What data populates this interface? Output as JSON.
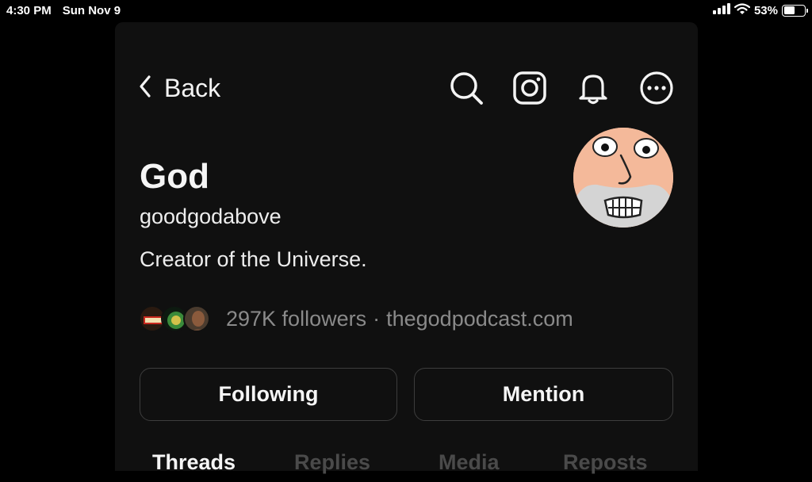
{
  "status_bar": {
    "time": "4:30 PM",
    "date": "Sun Nov 9",
    "battery": "53%",
    "battery_level": 0.53
  },
  "nav": {
    "back_label": "Back",
    "icons": [
      "search-icon",
      "instagram-icon",
      "bell-icon",
      "more-icon"
    ]
  },
  "profile": {
    "name": "God",
    "handle": "goodgodabove",
    "bio": "Creator of the Universe.",
    "followers": "297K followers",
    "separator": "·",
    "link": "thegodpodcast.com"
  },
  "actions": {
    "following_label": "Following",
    "mention_label": "Mention"
  },
  "tabs": [
    {
      "label": "Threads",
      "active": true
    },
    {
      "label": "Replies",
      "active": false
    },
    {
      "label": "Media",
      "active": false
    },
    {
      "label": "Reposts",
      "active": false
    }
  ],
  "colors": {
    "background": "#000000",
    "panel": "#101010",
    "primary_text": "#f5f5f5",
    "secondary_text": "#8a8a8a",
    "inactive_tab": "#4a4a4a",
    "button_border": "#3d3d3d"
  }
}
